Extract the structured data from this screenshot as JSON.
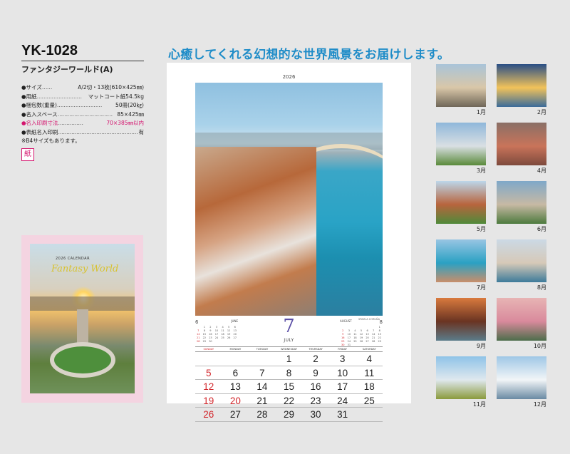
{
  "product": {
    "model": "YK-1028",
    "name": "ファンタジーワールド(A)",
    "specs": [
      {
        "label": "●サイズ",
        "dots": "……",
        "value": "A/2切・13枚(610×425㎜)",
        "pink": false
      },
      {
        "label": "●用紙",
        "dots": "………………………",
        "value": "マットコート紙54.5kg",
        "pink": false
      },
      {
        "label": "●梱包数(重量)",
        "dots": "………………………",
        "value": "50冊(20㎏)",
        "pink": false
      },
      {
        "label": "●名入スペース",
        "dots": "……………………………",
        "value": "85×425㎜",
        "pink": false
      },
      {
        "label": "●名入印刷寸法",
        "dots": "……………",
        "value": "70×385㎜以内",
        "pink": true
      },
      {
        "label": "●表紙名入印刷",
        "dots": "…………………………………………",
        "value": "有",
        "pink": false
      }
    ],
    "note": "※B4サイズもあります。",
    "paper_stamp": "紙"
  },
  "cover": {
    "calendar_text": "2026 CALENDAR",
    "logo_text": "Fantasy World"
  },
  "headline": "心癒してくれる幻想的な世界風景をお届けします。",
  "calendar": {
    "year": "2026",
    "month_number": "7",
    "month_name": "JULY",
    "photo_caption": "SPAIN  A CORUÑA",
    "weekdays": [
      "SUNDAY",
      "MONDAY",
      "TUESDAY",
      "WEDNESDAY",
      "THURSDAY",
      "FRIDAY",
      "SATURDAY"
    ],
    "weeks": [
      [
        "",
        "",
        "",
        "1",
        "2",
        "3",
        "4"
      ],
      [
        "5",
        "6",
        "7",
        "8",
        "9",
        "10",
        "11"
      ],
      [
        "12",
        "13",
        "14",
        "15",
        "16",
        "17",
        "18"
      ],
      [
        "19",
        "20",
        "21",
        "22",
        "23",
        "24",
        "25"
      ],
      [
        "26",
        "27",
        "28",
        "29",
        "30",
        "31",
        ""
      ]
    ],
    "holidays": [
      "20"
    ],
    "prev_month": {
      "number": "6",
      "name": "JUNE",
      "days": [
        "",
        "1",
        "2",
        "3",
        "4",
        "5",
        "6",
        "7",
        "8",
        "9",
        "10",
        "11",
        "12",
        "13",
        "14",
        "15",
        "16",
        "17",
        "18",
        "19",
        "20",
        "21",
        "22",
        "23",
        "24",
        "25",
        "26",
        "27",
        "28",
        "29",
        "30",
        "",
        "",
        "",
        ""
      ]
    },
    "next_month": {
      "number": "8",
      "name": "AUGUST",
      "days": [
        "",
        "",
        "",
        "",
        "",
        "",
        "1",
        "2",
        "3",
        "4",
        "5",
        "6",
        "7",
        "8",
        "9",
        "10",
        "11",
        "12",
        "13",
        "14",
        "15",
        "16",
        "17",
        "18",
        "19",
        "20",
        "21",
        "22",
        "23",
        "24",
        "25",
        "26",
        "27",
        "28",
        "29",
        "30",
        "31",
        "",
        "",
        "",
        "",
        ""
      ]
    }
  },
  "months": [
    {
      "label": "1月",
      "colors": [
        "#a9c4d9",
        "#d9c7a8",
        "#6f6658"
      ]
    },
    {
      "label": "2月",
      "colors": [
        "#2a4f86",
        "#f2c35a",
        "#3b6b9a"
      ]
    },
    {
      "label": "3月",
      "colors": [
        "#8fb7da",
        "#d9dfe3",
        "#5a8a3a"
      ]
    },
    {
      "label": "4月",
      "colors": [
        "#8a6f66",
        "#c9745a",
        "#7e4a3d"
      ]
    },
    {
      "label": "5月",
      "colors": [
        "#bcd6ea",
        "#b8643d",
        "#4f8a3a"
      ]
    },
    {
      "label": "6月",
      "colors": [
        "#7fa8c9",
        "#c7b9a4",
        "#4d7a3e"
      ]
    },
    {
      "label": "7月",
      "colors": [
        "#98c5e3",
        "#2aa1c3",
        "#c98e6a"
      ]
    },
    {
      "label": "8月",
      "colors": [
        "#cbd9e5",
        "#d6c9b8",
        "#3e7b9a"
      ]
    },
    {
      "label": "9月",
      "colors": [
        "#d97a3e",
        "#6a3422",
        "#5b7c8a"
      ]
    },
    {
      "label": "10月",
      "colors": [
        "#e7b4b4",
        "#d98a9c",
        "#4c6d4a"
      ]
    },
    {
      "label": "11月",
      "colors": [
        "#8fc3e8",
        "#dfe8ee",
        "#8a9a3c"
      ]
    },
    {
      "label": "12月",
      "colors": [
        "#9fc7e6",
        "#f2f5f7",
        "#6a8aa3"
      ]
    }
  ]
}
